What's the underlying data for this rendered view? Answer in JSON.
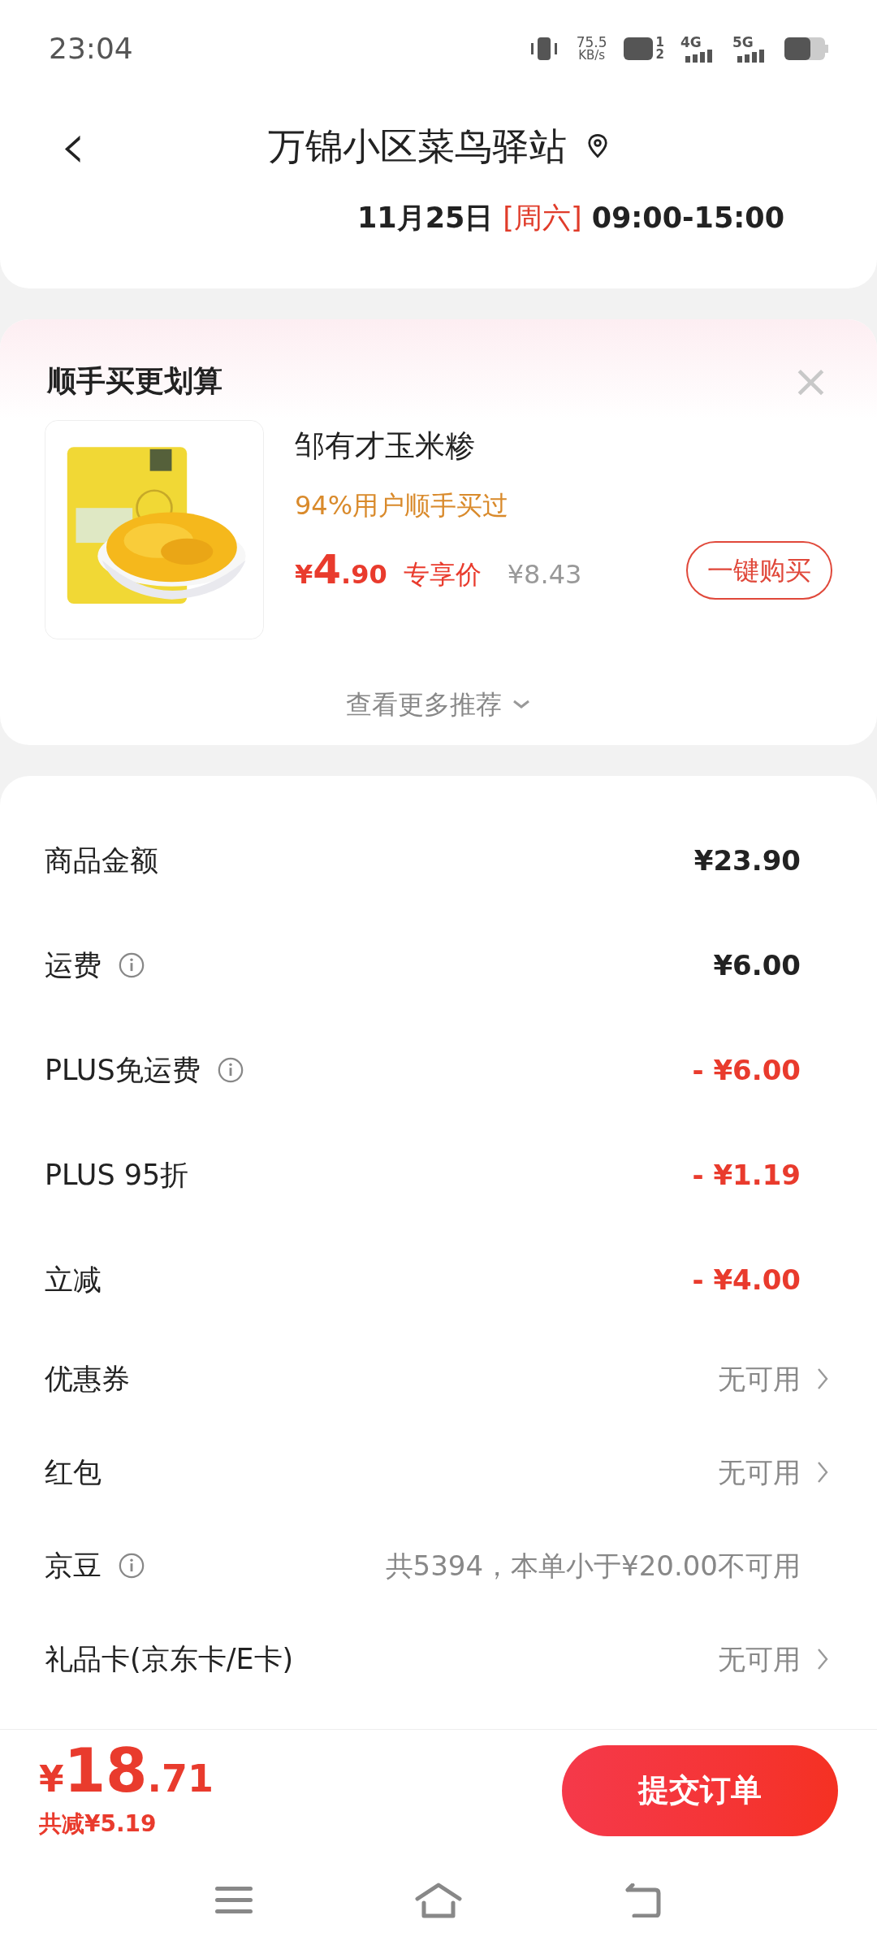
{
  "status_bar": {
    "time": "23:04",
    "net_speed": "75.5",
    "net_unit": "KB/s",
    "hd_sup": "1",
    "hd_sub": "2",
    "sig1": "4G",
    "sig2": "5G"
  },
  "header": {
    "back": "‹",
    "title": "万锦小区菜鸟驿站",
    "date": "11月25日",
    "weekday": "[周六]",
    "time_range": "09:00-15:00"
  },
  "recommend": {
    "title": "顺手买更划算",
    "close": "×",
    "product": {
      "name": "邹有才玉米糁",
      "note": "94%用户顺手买过",
      "price_symbol": "¥",
      "price_int": "4",
      "price_dec": ".90",
      "price_tag": "专享价",
      "original_price": "¥8.43",
      "buy_button": "一键购买"
    },
    "more": "查看更多推荐"
  },
  "fees": [
    {
      "kind": "amount",
      "label": "商品金额",
      "info": false,
      "value": "¥23.90"
    },
    {
      "kind": "amount",
      "label": "运费",
      "info": true,
      "value": "¥6.00"
    },
    {
      "kind": "discount",
      "label": "PLUS免运费",
      "info": true,
      "value": "- ¥6.00"
    },
    {
      "kind": "discount",
      "label": "PLUS 95折",
      "info": false,
      "value": "- ¥1.19"
    },
    {
      "kind": "discount",
      "label": "立减",
      "info": false,
      "value": "- ¥4.00"
    },
    {
      "kind": "option",
      "label": "优惠券",
      "info": false,
      "value": "无可用"
    },
    {
      "kind": "option",
      "label": "红包",
      "info": false,
      "value": "无可用"
    },
    {
      "kind": "note",
      "label": "京豆",
      "info": true,
      "value": "共5394，本单小于¥20.00不可用"
    },
    {
      "kind": "option",
      "label": "礼品卡(京东卡/E卡)",
      "info": false,
      "value": "无可用"
    }
  ],
  "footer": {
    "symbol": "¥",
    "total_int": "18",
    "total_dec": ".71",
    "saved": "共减¥5.19",
    "submit": "提交订单"
  }
}
